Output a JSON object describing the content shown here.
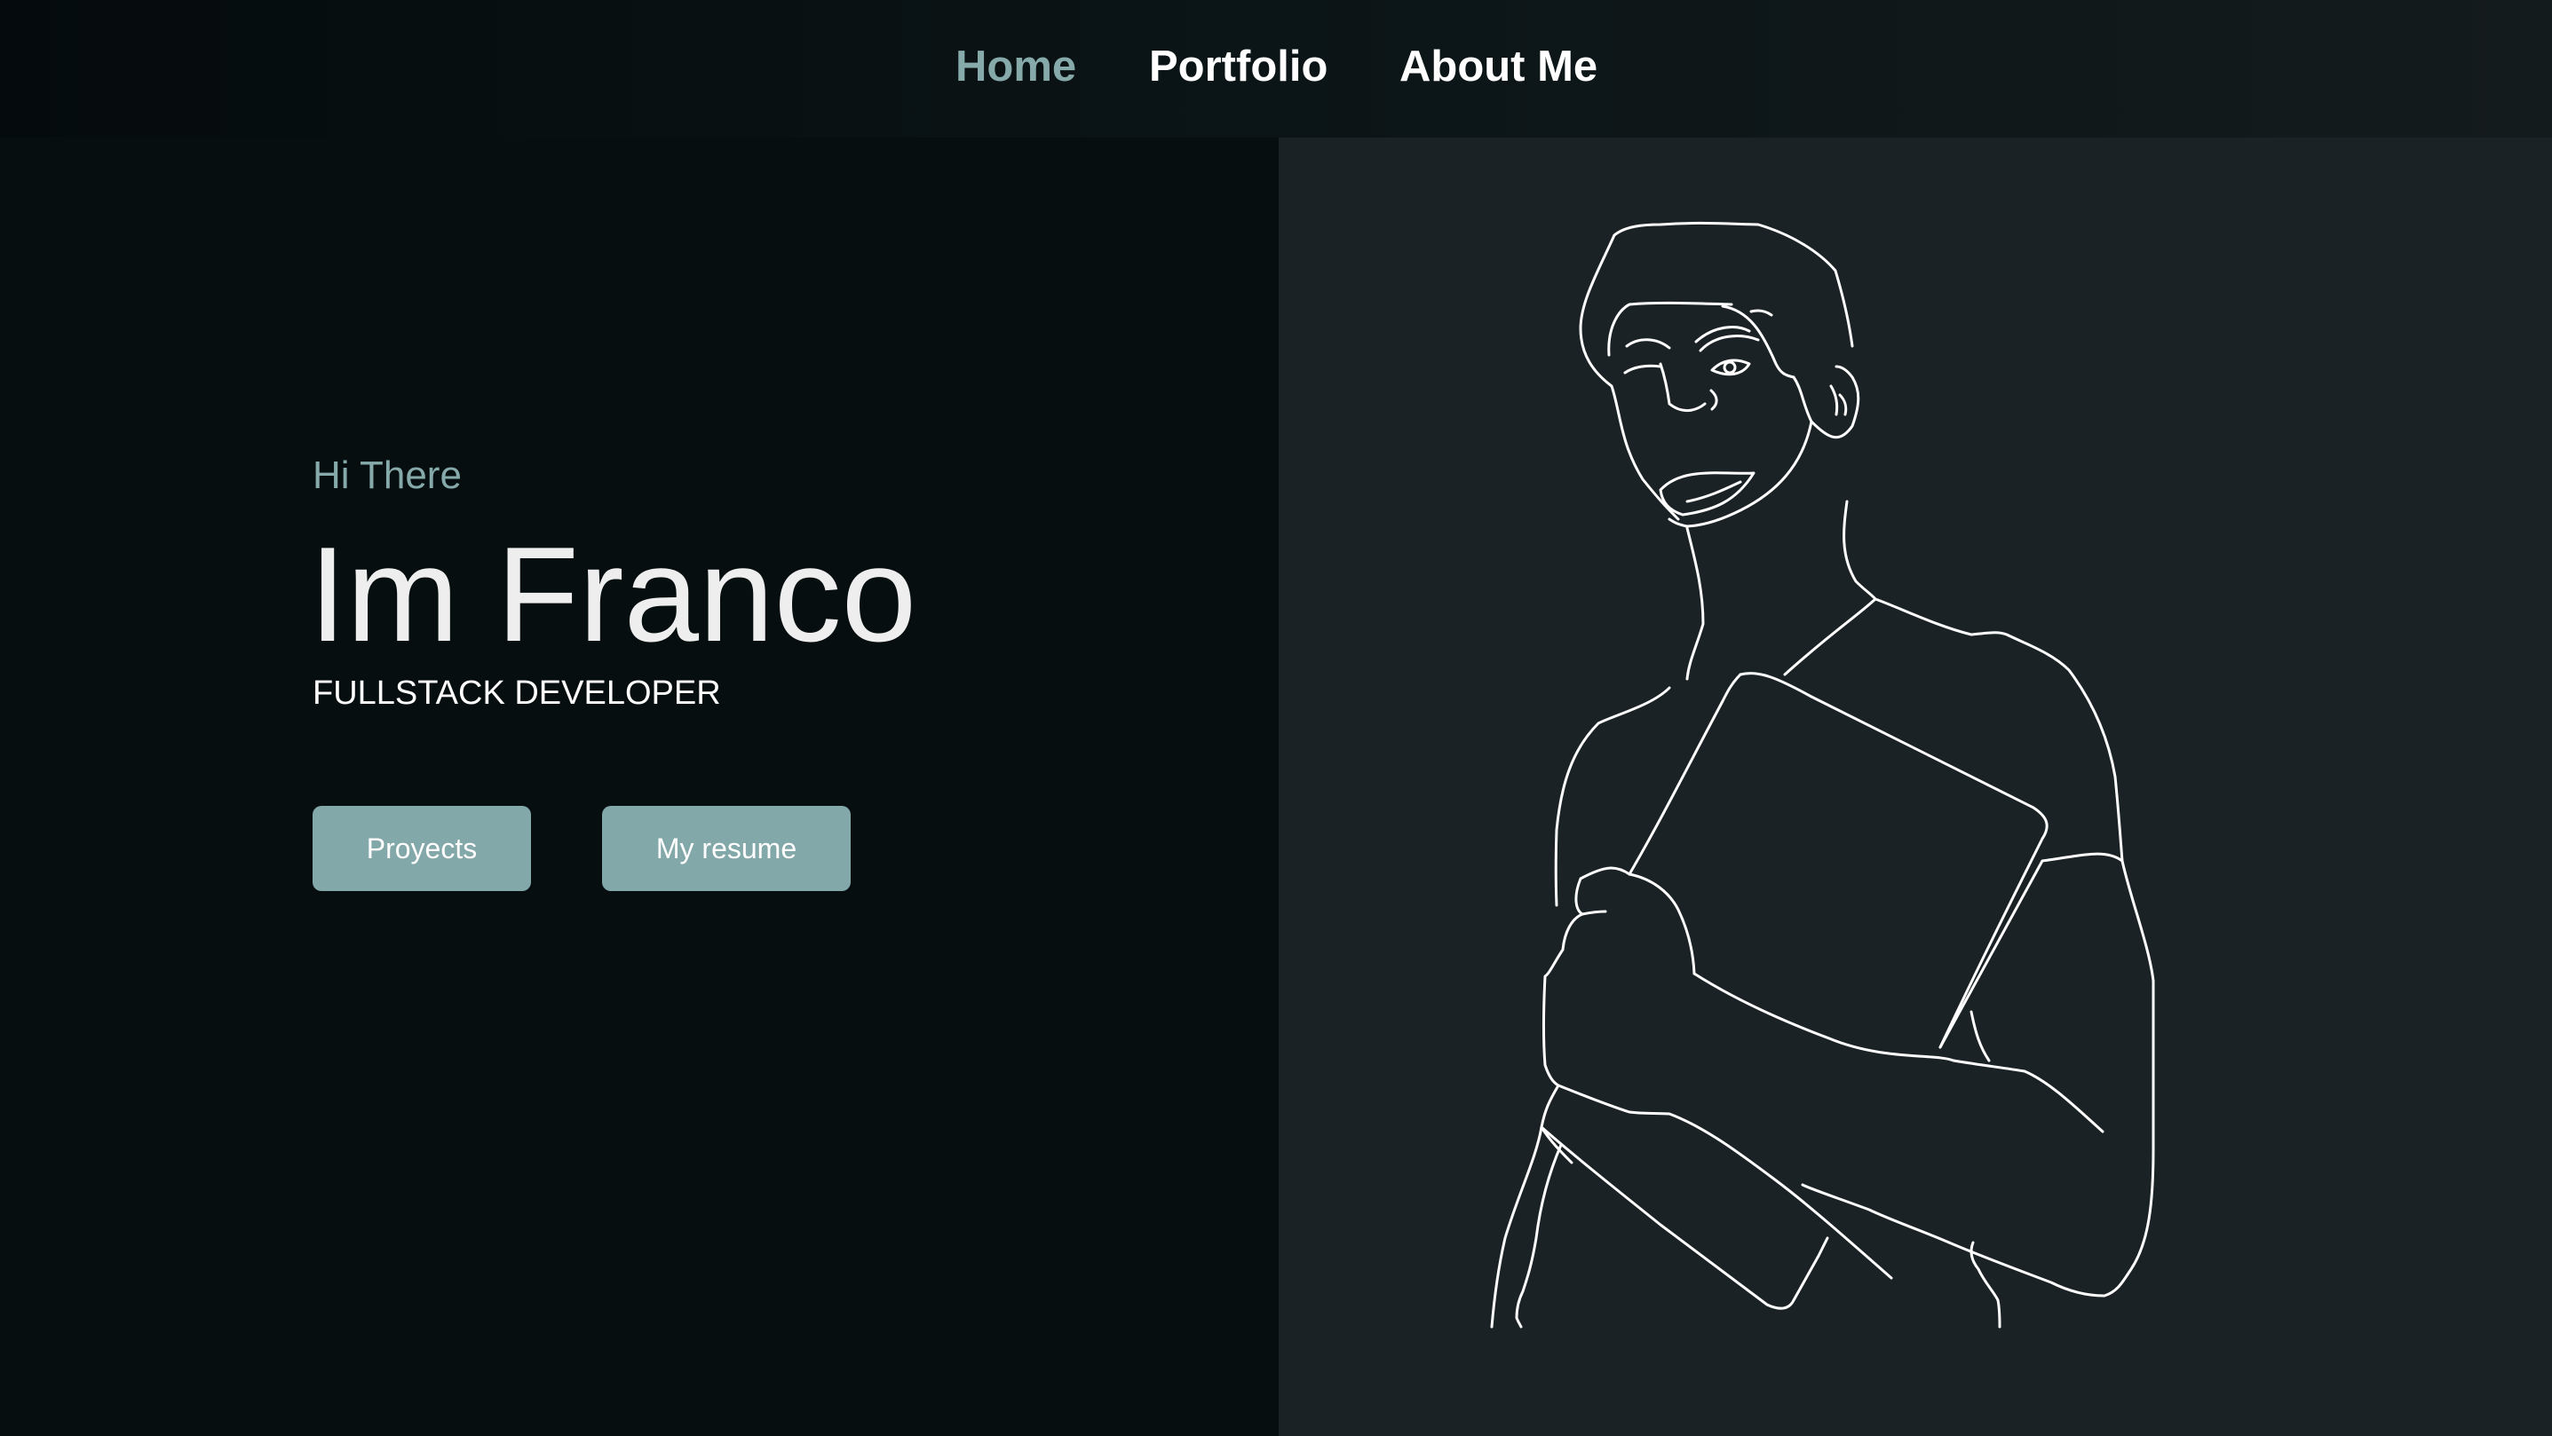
{
  "nav": {
    "items": [
      {
        "label": "Home",
        "active": true
      },
      {
        "label": "Portfolio",
        "active": false
      },
      {
        "label": "About Me",
        "active": false
      }
    ]
  },
  "hero": {
    "greeting": "Hi There",
    "name": "Im Franco",
    "role": "FULLSTACK DEVELOPER",
    "buttons": {
      "projects": "Proyects",
      "resume": "My resume"
    }
  },
  "colors": {
    "accent": "#86a9aa",
    "button": "#83a8aa",
    "left_background": "#060e10",
    "right_background": "#1b2225",
    "text": "#ffffff"
  },
  "illustration": {
    "icon": "person-holding-laptop-line-art"
  }
}
